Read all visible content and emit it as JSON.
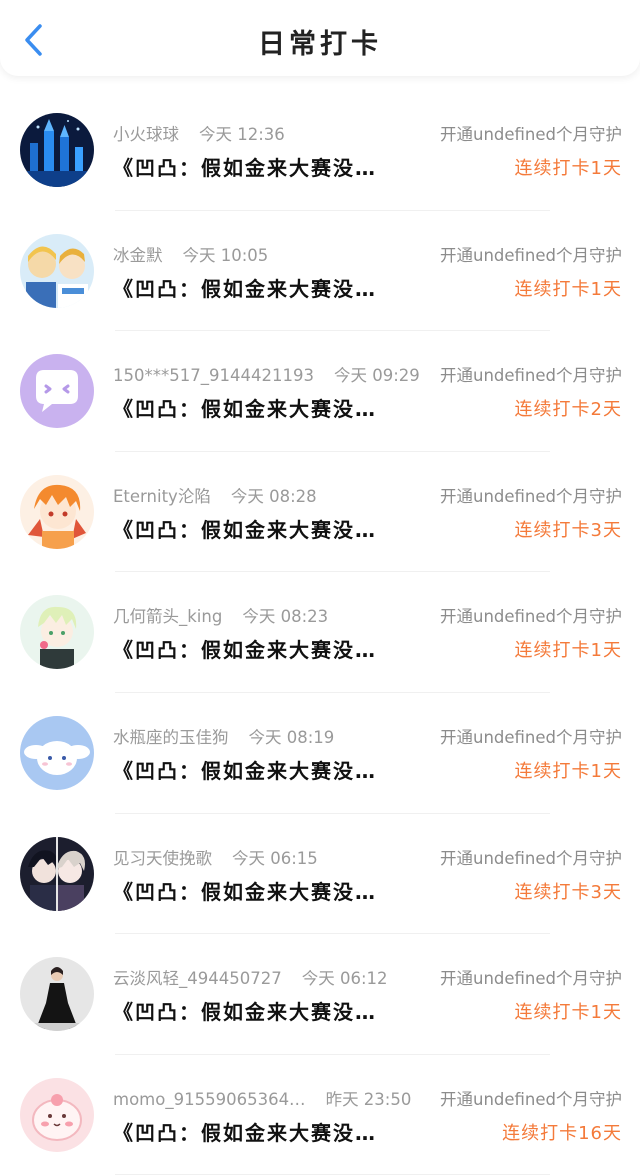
{
  "header": {
    "title": "日常打卡"
  },
  "entries": [
    {
      "name": "小火球球",
      "time": "今天 12:36",
      "guard": "开通undefined个月守护",
      "message": "《凹凸：假如金来大赛没…",
      "streak": "连续打卡1天",
      "avatar_icon": "blue-castle-avatar"
    },
    {
      "name": "冰金默",
      "time": "今天 10:05",
      "guard": "开通undefined个月守护",
      "message": "《凹凸：假如金来大赛没…",
      "streak": "连续打卡1天",
      "avatar_icon": "anime-group-avatar"
    },
    {
      "name": "150***517_9144421193",
      "time": "今天 09:29",
      "guard": "开通undefined个月守护",
      "message": "《凹凸：假如金来大赛没…",
      "streak": "连续打卡2天",
      "avatar_icon": "chat-bubble-avatar"
    },
    {
      "name": "Eternity沦陷",
      "time": "今天 08:28",
      "guard": "开通undefined个月守护",
      "message": "《凹凸：假如金来大赛没…",
      "streak": "连续打卡3天",
      "avatar_icon": "orange-hair-anime-avatar"
    },
    {
      "name": "几何箭头_king",
      "time": "今天 08:23",
      "guard": "开通undefined个月守护",
      "message": "《凹凸：假如金来大赛没…",
      "streak": "连续打卡1天",
      "avatar_icon": "green-anime-avatar"
    },
    {
      "name": "水瓶座的玉佳狗",
      "time": "今天 08:19",
      "guard": "开通undefined个月守护",
      "message": "《凹凸：假如金来大赛没…",
      "streak": "连续打卡1天",
      "avatar_icon": "cinnamoroll-avatar"
    },
    {
      "name": "见习天使挽歌",
      "time": "今天 06:15",
      "guard": "开通undefined个月守护",
      "message": "《凹凸：假如金来大赛没…",
      "streak": "连续打卡3天",
      "avatar_icon": "dark-duo-anime-avatar"
    },
    {
      "name": "云淡风轻_494450727",
      "time": "今天 06:12",
      "guard": "开通undefined个月守护",
      "message": "《凹凸：假如金来大赛没…",
      "streak": "连续打卡1天",
      "avatar_icon": "black-dress-avatar"
    },
    {
      "name": "momo_91559065364…",
      "time": "昨天 23:50",
      "guard": "开通undefined个月守护",
      "message": "《凹凸：假如金来大赛没…",
      "streak": "连续打卡16天",
      "avatar_icon": "pink-blob-avatar"
    }
  ],
  "colors": {
    "accent_blue": "#3a8df0",
    "streak_orange": "#f47a3a",
    "meta_gray": "#9a9a9a"
  }
}
